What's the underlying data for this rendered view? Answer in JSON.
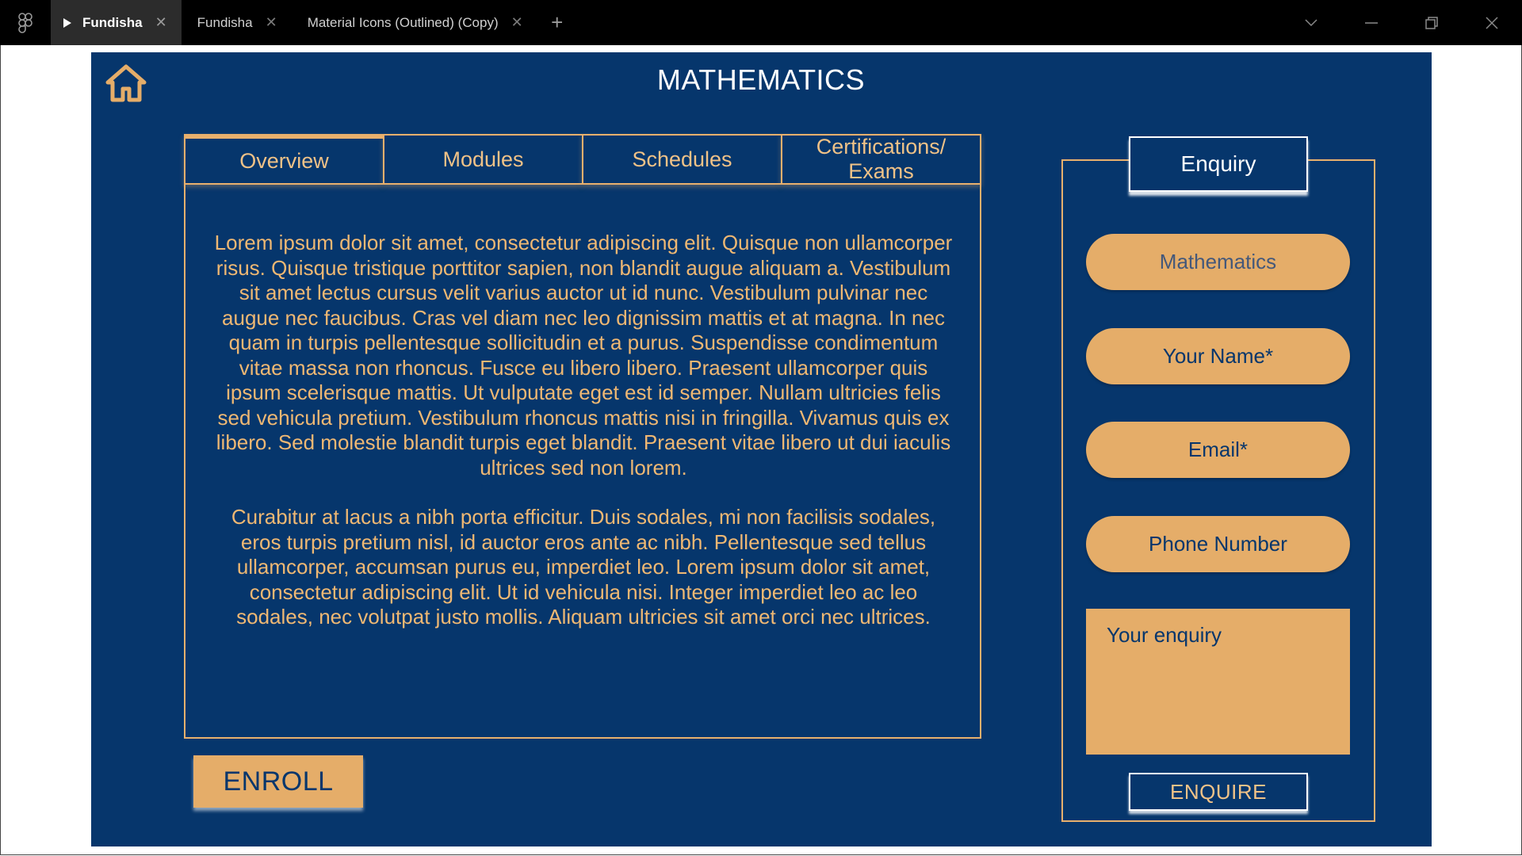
{
  "window": {
    "tabs": [
      {
        "label": "Fundisha",
        "active": true
      },
      {
        "label": "Fundisha",
        "active": false
      },
      {
        "label": "Material Icons (Outlined) (Copy)",
        "active": false
      }
    ],
    "new_tab_label": "+"
  },
  "page": {
    "title": "MATHEMATICS",
    "colors": {
      "background": "#06366c",
      "accent": "#e5ad69"
    }
  },
  "course_tabs": [
    {
      "label": "Overview",
      "active": true
    },
    {
      "label": "Modules",
      "active": false
    },
    {
      "label": "Schedules",
      "active": false
    },
    {
      "label": "Certifications/ Exams",
      "active": false
    }
  ],
  "overview": {
    "paragraphs": [
      "Lorem ipsum dolor sit amet, consectetur adipiscing elit. Quisque non ullamcorper risus. Quisque tristique porttitor sapien, non blandit augue aliquam a. Vestibulum sit amet lectus cursus velit varius auctor ut id nunc. Vestibulum pulvinar nec augue nec faucibus. Cras vel diam nec leo dignissim mattis et at magna. In nec quam in turpis pellentesque sollicitudin et a purus. Suspendisse condimentum vitae massa non rhoncus. Fusce eu libero libero. Praesent ullamcorper quis ipsum scelerisque mattis. Ut vulputate eget est id semper. Nullam ultricies felis sed vehicula pretium. Vestibulum rhoncus mattis nisi in fringilla. Vivamus quis ex libero. Sed molestie blandit turpis eget blandit. Praesent vitae libero ut dui iaculis ultrices sed non lorem.",
      "Curabitur at lacus a nibh porta efficitur. Duis sodales, mi non facilisis sodales, eros turpis pretium nisl, id auctor eros ante ac nibh. Pellentesque sed tellus ullamcorper, accumsan purus eu, imperdiet leo. Lorem ipsum dolor sit amet, consectetur adipiscing elit. Ut id vehicula nisi. Integer imperdiet leo ac leo sodales, nec volutpat justo mollis. Aliquam ultricies sit amet orci nec ultrices."
    ]
  },
  "enroll_label": "ENROLL",
  "enquiry": {
    "header": "Enquiry",
    "course_value": "Mathematics",
    "name_placeholder": "Your Name*",
    "email_placeholder": "Email*",
    "phone_placeholder": "Phone Number",
    "enquiry_placeholder": "Your enquiry",
    "submit_label": "ENQUIRE"
  }
}
